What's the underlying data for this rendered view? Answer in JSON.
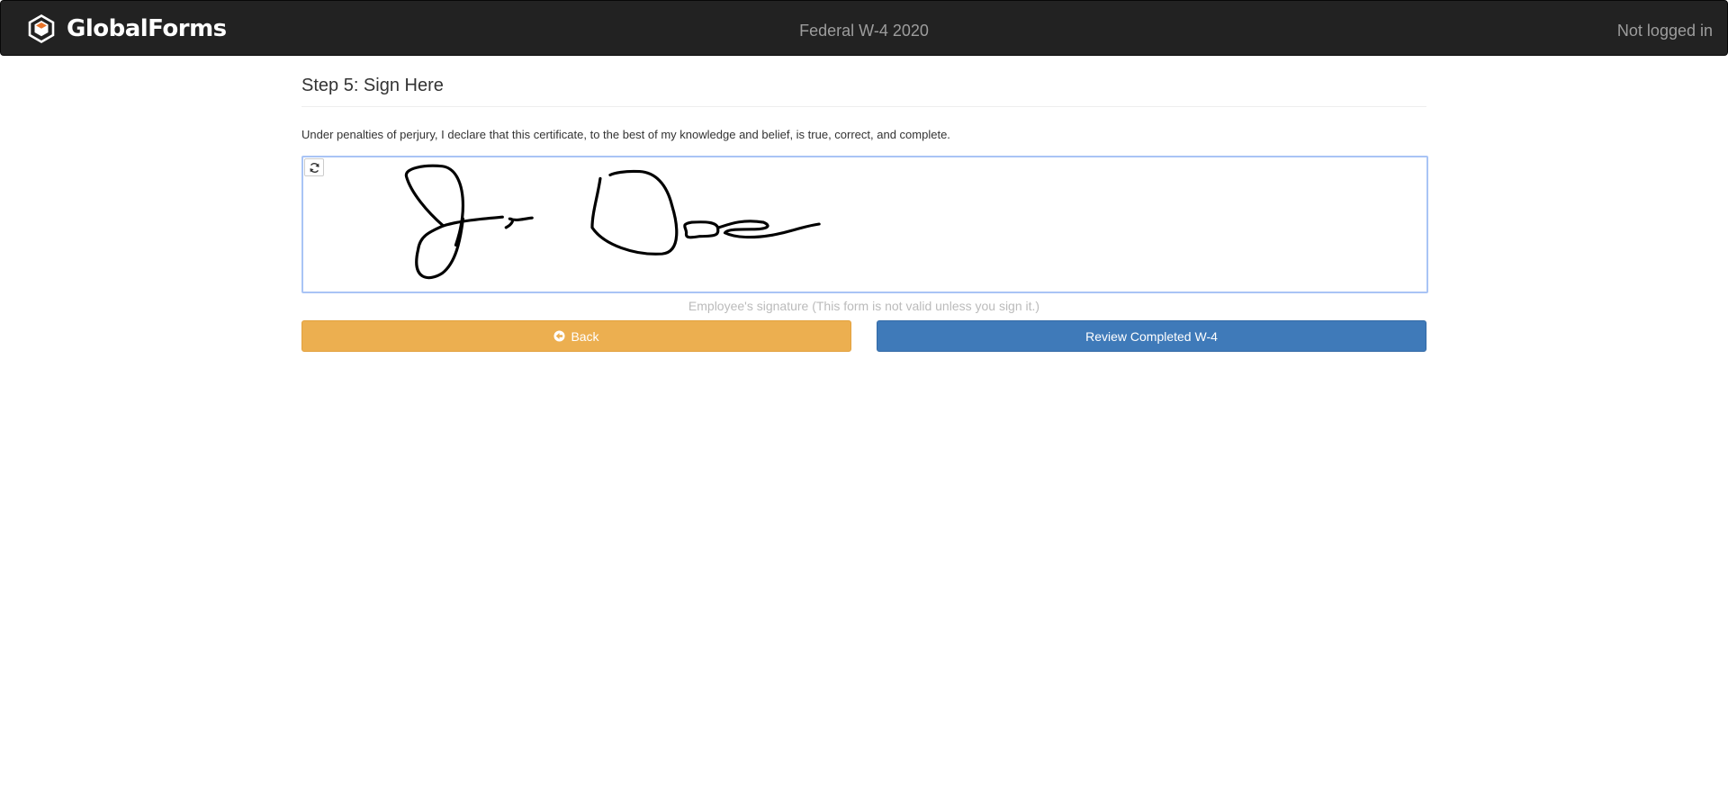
{
  "navbar": {
    "brand": "GlobalForms",
    "brand_logo": "hexagon-cube-logo",
    "form_title": "Federal W-4 2020",
    "login_status": "Not logged in",
    "brand_accent": "#e8742a"
  },
  "step": {
    "title": "Step 5: Sign Here",
    "declaration": "Under penalties of perjury, I declare that this certificate, to the best of my knowledge and belief, is true, correct, and complete."
  },
  "signature": {
    "reset_icon": "refresh-icon",
    "caption": "Employee's signature (This form is not valid unless you sign it.)"
  },
  "actions": {
    "back_label": "Back",
    "back_icon": "arrow-circle-left-icon",
    "review_label": "Review Completed W-4",
    "back_color": "#ecaf50",
    "review_color": "#3f7ab9"
  }
}
